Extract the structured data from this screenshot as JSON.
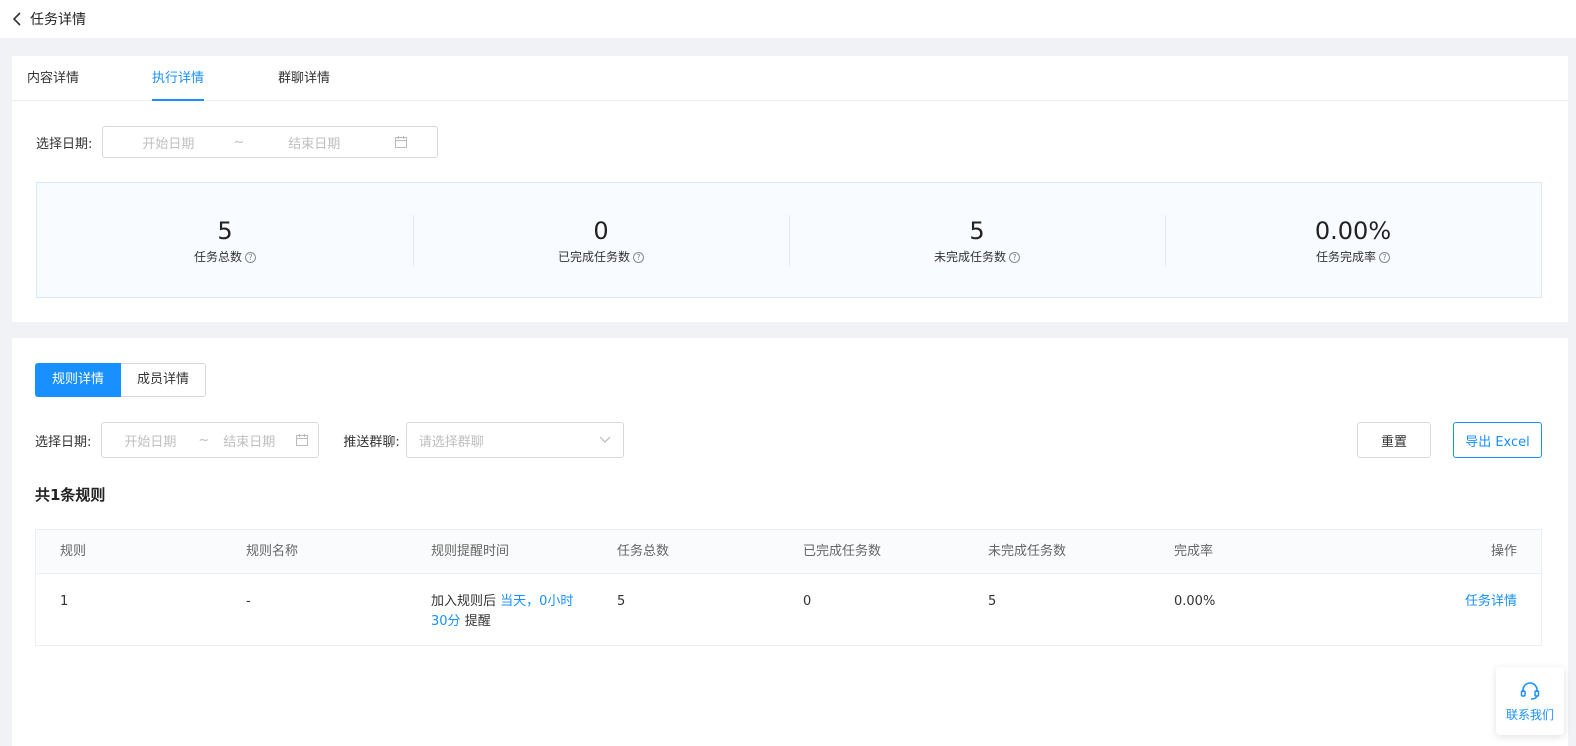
{
  "header": {
    "title": "任务详情"
  },
  "tabs": [
    {
      "label": "内容详情"
    },
    {
      "label": "执行详情"
    },
    {
      "label": "群聊详情"
    }
  ],
  "date_filter": {
    "label": "选择日期:",
    "start_placeholder": "开始日期",
    "separator": "~",
    "end_placeholder": "结束日期"
  },
  "stats": [
    {
      "value": "5",
      "label": "任务总数"
    },
    {
      "value": "0",
      "label": "已完成任务数"
    },
    {
      "value": "5",
      "label": "未完成任务数"
    },
    {
      "value": "0.00%",
      "label": "任务完成率"
    }
  ],
  "detail_tabs": {
    "rule": "规则详情",
    "member": "成员详情"
  },
  "filter": {
    "date_label": "选择日期:",
    "start_placeholder": "开始日期",
    "separator": "~",
    "end_placeholder": "结束日期",
    "group_label": "推送群聊:",
    "group_placeholder": "请选择群聊"
  },
  "buttons": {
    "reset": "重置",
    "export": "导出 Excel"
  },
  "rule_count": "共1条规则",
  "table": {
    "headers": [
      "规则",
      "规则名称",
      "规则提醒时间",
      "任务总数",
      "已完成任务数",
      "未完成任务数",
      "完成率",
      "操作"
    ],
    "rows": [
      {
        "rule": "1",
        "name": "-",
        "remind_prefix": "加入规则后",
        "remind_highlight_1": "当天，0小时",
        "remind_highlight_2": "30分",
        "remind_suffix": "提醒",
        "total": "5",
        "done": "0",
        "undone": "5",
        "rate": "0.00%",
        "action": "任务详情"
      }
    ]
  },
  "contact": {
    "label": "联系我们"
  },
  "colors": {
    "primary": "#1890ff",
    "page_bg": "#f0f2f5"
  }
}
